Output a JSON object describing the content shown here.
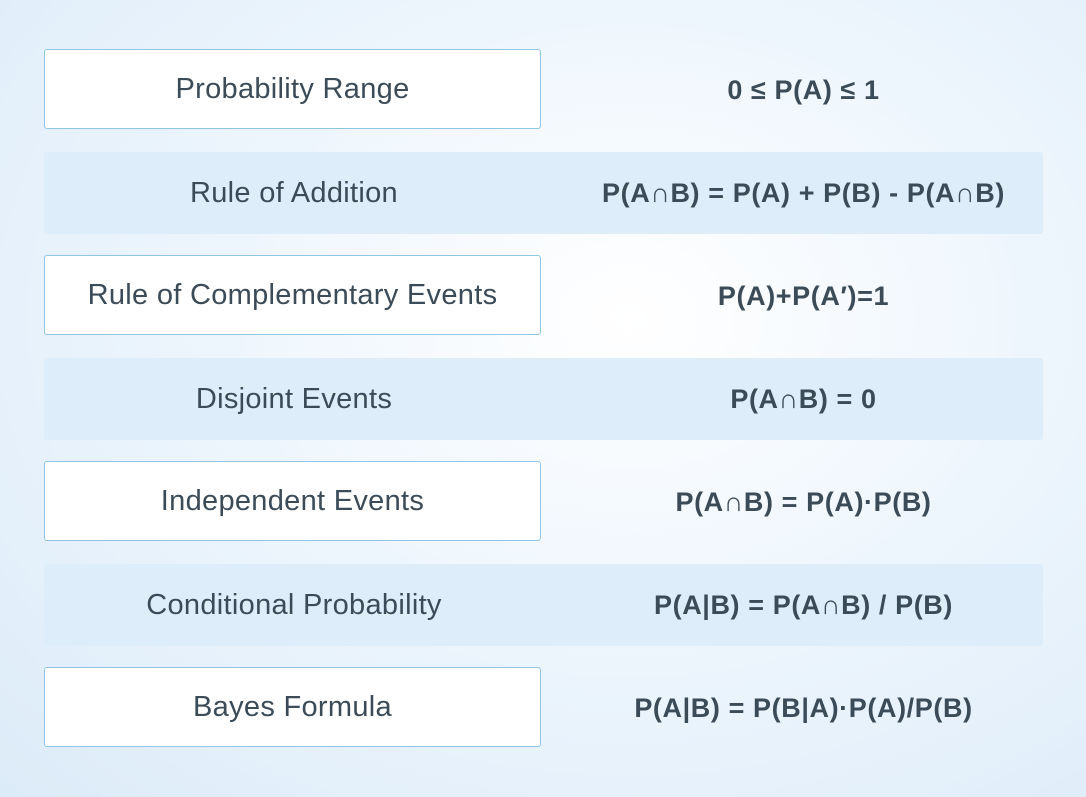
{
  "rules": [
    {
      "name": "Probability Range",
      "formula": "0 ≤ P(A) ≤ 1"
    },
    {
      "name": "Rule of Addition",
      "formula": "P(A∩B) = P(A) + P(B) - P(A∩B)"
    },
    {
      "name": "Rule of Complementary Events",
      "formula": "P(A)+P(A′)=1"
    },
    {
      "name": "Disjoint Events",
      "formula": "P(A∩B) = 0"
    },
    {
      "name": "Independent Events",
      "formula": "P(A∩B) = P(A)·P(B)"
    },
    {
      "name": "Conditional Probability",
      "formula": "P(A|B) = P(A∩B) / P(B)"
    },
    {
      "name": "Bayes Formula",
      "formula": "P(A|B) = P(B|A)·P(A)/P(B)"
    }
  ],
  "colors": {
    "text": "#3b4b58",
    "box_border": "#8ec6e6",
    "shaded_row": "#ddeefa"
  }
}
